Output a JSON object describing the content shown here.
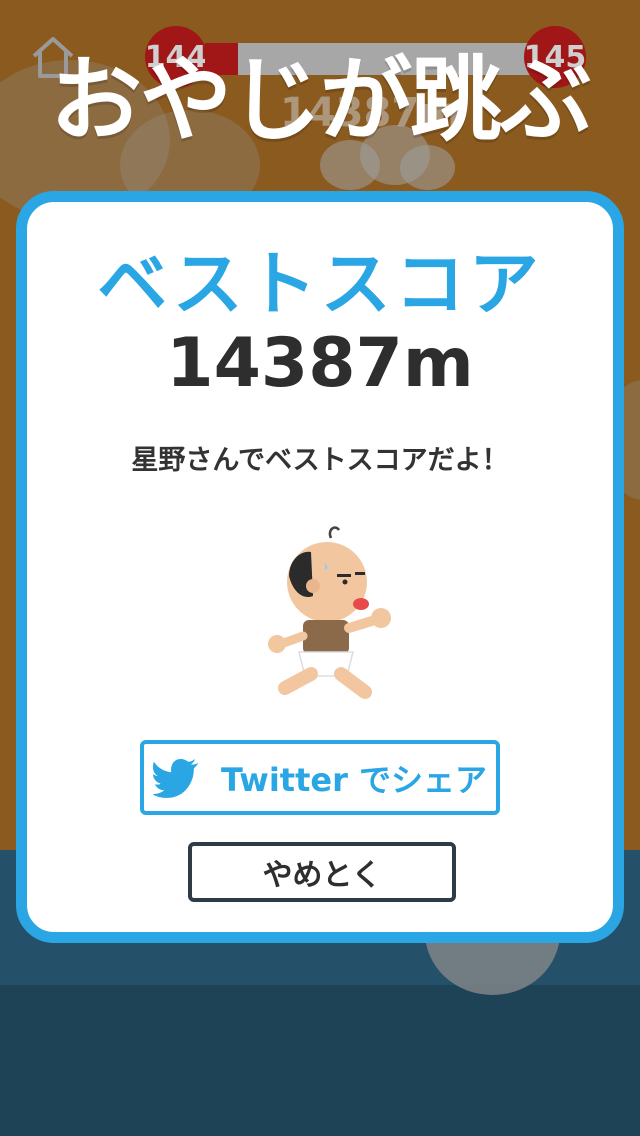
{
  "hud": {
    "left_level": "144",
    "right_level": "145",
    "level_progress": 0.1,
    "distance": "14387m",
    "icon": "home-icon"
  },
  "game": {
    "title": "おやじが跳ぶ"
  },
  "dialog": {
    "title": "ベストスコア",
    "score": "14387m",
    "message": "星野さんでベストスコアだよ！",
    "twitter_button": "Twitter でシェア",
    "quit_button": "やめとく"
  },
  "colors": {
    "accent_blue": "#2aa6e4",
    "badge_red": "#a11616",
    "sky_brown": "#8a5a1f",
    "sea": "#24506a"
  }
}
